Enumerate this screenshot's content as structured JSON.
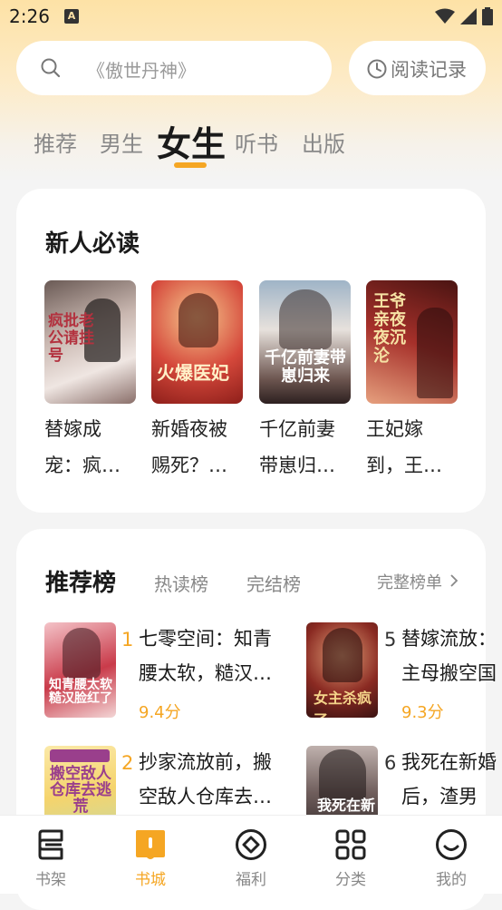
{
  "status": {
    "time": "2:26"
  },
  "search": {
    "placeholder": "《傲世丹神》",
    "history_label": "阅读记录"
  },
  "tabs": [
    {
      "label": "推荐"
    },
    {
      "label": "男生"
    },
    {
      "label": "女生"
    },
    {
      "label": "听书"
    },
    {
      "label": "出版"
    }
  ],
  "active_tab": "女生",
  "new_reader": {
    "title": "新人必读",
    "books": [
      {
        "title": "替嫁成宠：疯…",
        "cover_text": "疯批老公请挂号"
      },
      {
        "title": "新婚夜被赐死？…",
        "cover_text": "火爆医妃"
      },
      {
        "title": "千亿前妻带崽归…",
        "cover_text": "千亿前妻带崽归来"
      },
      {
        "title": "王妃嫁到，王…",
        "cover_text": "王爷亲夜夜沉沦"
      }
    ]
  },
  "ranking": {
    "title": "推荐榜",
    "tabs": [
      "热读榜",
      "完结榜"
    ],
    "more_label": "完整榜单",
    "items": [
      {
        "rank": "1",
        "title": "七零空间：知青腰太软，糙汉…",
        "score": "9.4分",
        "cover_text": "知青腰太软糙汉脸红了"
      },
      {
        "rank": "2",
        "title": "抄家流放前，搬空敌人仓库去…",
        "score": "",
        "cover_text": "搬空敌人仓库去逃荒"
      },
      {
        "rank": "5",
        "title": "替嫁流放：主母搬空国",
        "score": "9.3分",
        "cover_text": "女主杀疯了"
      },
      {
        "rank": "6",
        "title": "我死在新婚后，渣男",
        "score": "",
        "cover_text": "我死在新婚"
      }
    ]
  },
  "nav": [
    {
      "label": "书架",
      "icon": "bookshelf-icon"
    },
    {
      "label": "书城",
      "icon": "bookstore-icon"
    },
    {
      "label": "福利",
      "icon": "welfare-icon"
    },
    {
      "label": "分类",
      "icon": "category-icon"
    },
    {
      "label": "我的",
      "icon": "profile-icon"
    }
  ],
  "colors": {
    "accent": "#f5a623",
    "header_bg": "#fde2a6"
  }
}
